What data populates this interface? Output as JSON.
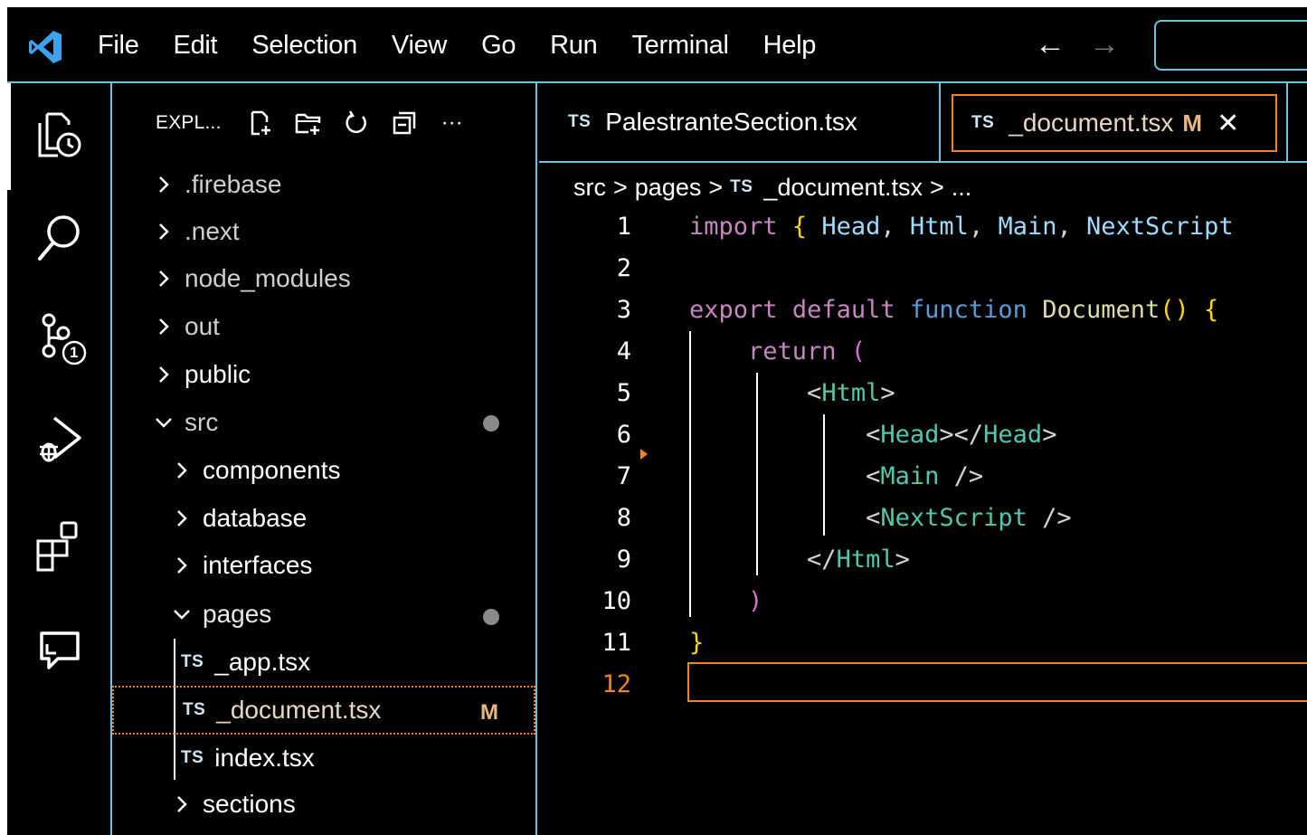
{
  "menubar": {
    "items": [
      "File",
      "Edit",
      "Selection",
      "View",
      "Go",
      "Run",
      "Terminal",
      "Help"
    ],
    "back_arrow": "←",
    "forward_arrow": "→"
  },
  "activitybar": {
    "icons": [
      "explorer-icon",
      "search-icon",
      "source-control-icon",
      "run-debug-icon",
      "extensions-icon",
      "remote-chat-icon"
    ],
    "source_control_badge": "1"
  },
  "sidebar": {
    "title": "EXPL...",
    "actions": [
      "new-file-icon",
      "new-folder-icon",
      "refresh-icon",
      "collapse-all-icon",
      "more-icon"
    ],
    "more_label": "···",
    "items": [
      {
        "label": ".firebase",
        "type": "folder",
        "expanded": false,
        "depth": 0
      },
      {
        "label": ".next",
        "type": "folder",
        "expanded": false,
        "depth": 0
      },
      {
        "label": "node_modules",
        "type": "folder",
        "expanded": false,
        "depth": 0
      },
      {
        "label": "out",
        "type": "folder",
        "expanded": false,
        "depth": 0
      },
      {
        "label": "public",
        "type": "folder",
        "expanded": false,
        "depth": 0
      },
      {
        "label": "src",
        "type": "folder",
        "expanded": true,
        "depth": 0
      },
      {
        "label": "components",
        "type": "folder",
        "expanded": false,
        "depth": 1
      },
      {
        "label": "database",
        "type": "folder",
        "expanded": false,
        "depth": 1
      },
      {
        "label": "interfaces",
        "type": "folder",
        "expanded": false,
        "depth": 1
      },
      {
        "label": "pages",
        "type": "folder",
        "expanded": true,
        "depth": 1
      },
      {
        "label": "_app.tsx",
        "type": "file",
        "depth": 2
      },
      {
        "label": "_document.tsx",
        "type": "file",
        "depth": 2,
        "status": "M"
      },
      {
        "label": "index.tsx",
        "type": "file",
        "depth": 2
      },
      {
        "label": "sections",
        "type": "folder",
        "expanded": false,
        "depth": 1
      }
    ],
    "ts_badge": "TS"
  },
  "editor": {
    "tabs": [
      {
        "label": "PalestranteSection.tsx",
        "active": false
      },
      {
        "label": "_document.tsx",
        "active": true,
        "status": "M",
        "close": "✕"
      }
    ],
    "breadcrumb": {
      "parts": [
        "src",
        "pages",
        "_document.tsx",
        "..."
      ],
      "separator": ">"
    },
    "line_numbers": [
      "1",
      "2",
      "3",
      "4",
      "5",
      "6",
      "7",
      "8",
      "9",
      "10",
      "11",
      "12"
    ],
    "active_line": "12"
  }
}
